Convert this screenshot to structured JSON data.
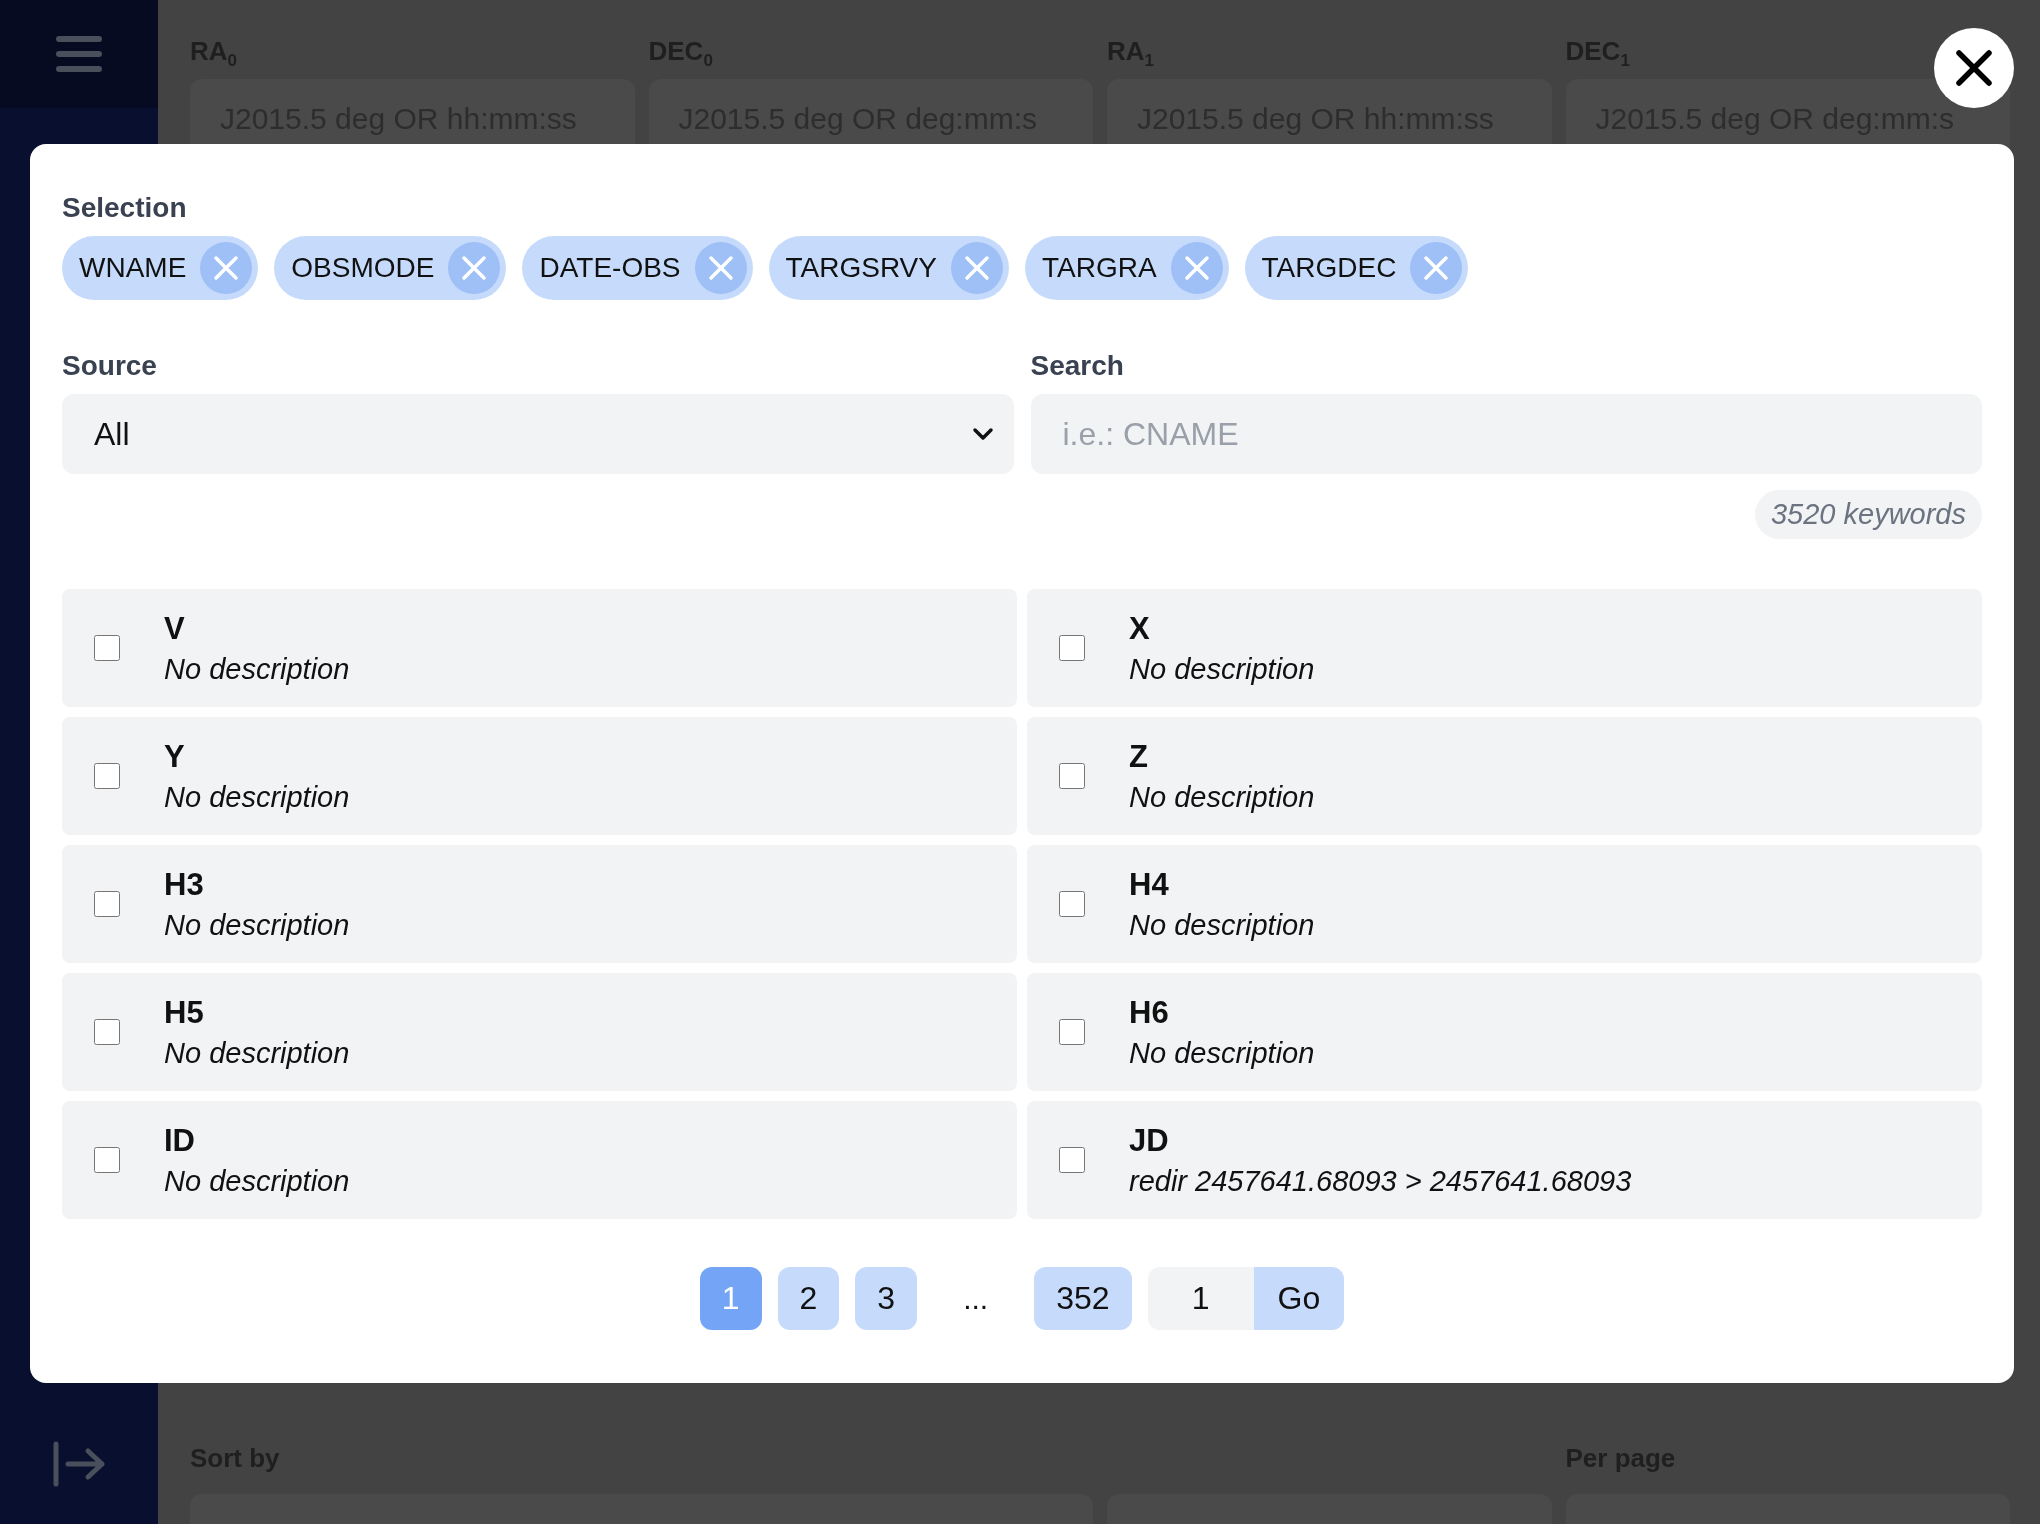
{
  "background": {
    "coordinate_fields": [
      {
        "label": "RA$_{0}$",
        "placeholder": "J2015.5 deg OR hh:mm:ss"
      },
      {
        "label": "DEC$_{0}$",
        "placeholder": "J2015.5 deg OR deg:mm:s"
      },
      {
        "label": "RA$_{1}$",
        "placeholder": "J2015.5 deg OR hh:mm:ss"
      },
      {
        "label": "DEC$_{1}$",
        "placeholder": "J2015.5 deg OR deg:mm:s"
      }
    ],
    "bottom_labels": [
      "Sort by",
      "Per page"
    ]
  },
  "modal": {
    "selection": {
      "label": "Selection",
      "chips": [
        "WNAME",
        "OBSMODE",
        "DATE-OBS",
        "TARGSRVY",
        "TARGRA",
        "TARGDEC"
      ]
    },
    "source": {
      "label": "Source",
      "value": "All"
    },
    "search": {
      "label": "Search",
      "placeholder": "i.e.: CNAME"
    },
    "count": "3520 keywords",
    "keywords": [
      {
        "name": "V",
        "description": "No description",
        "checked": false
      },
      {
        "name": "X",
        "description": "No description",
        "checked": false
      },
      {
        "name": "Y",
        "description": "No description",
        "checked": false
      },
      {
        "name": "Z",
        "description": "No description",
        "checked": false
      },
      {
        "name": "H3",
        "description": "No description",
        "checked": false
      },
      {
        "name": "H4",
        "description": "No description",
        "checked": false
      },
      {
        "name": "H5",
        "description": "No description",
        "checked": false
      },
      {
        "name": "H6",
        "description": "No description",
        "checked": false
      },
      {
        "name": "ID",
        "description": "No description",
        "checked": false
      },
      {
        "name": "JD",
        "description": "redir 2457641.68093 > 2457641.68093",
        "checked": false
      }
    ],
    "pagination": {
      "pages": [
        {
          "label": "1",
          "selected": true
        },
        {
          "label": "2",
          "selected": false
        },
        {
          "label": "3",
          "selected": false
        }
      ],
      "ellipsis": "...",
      "last": {
        "label": "352",
        "selected": false
      },
      "goto_value": "1",
      "go": "Go"
    }
  }
}
